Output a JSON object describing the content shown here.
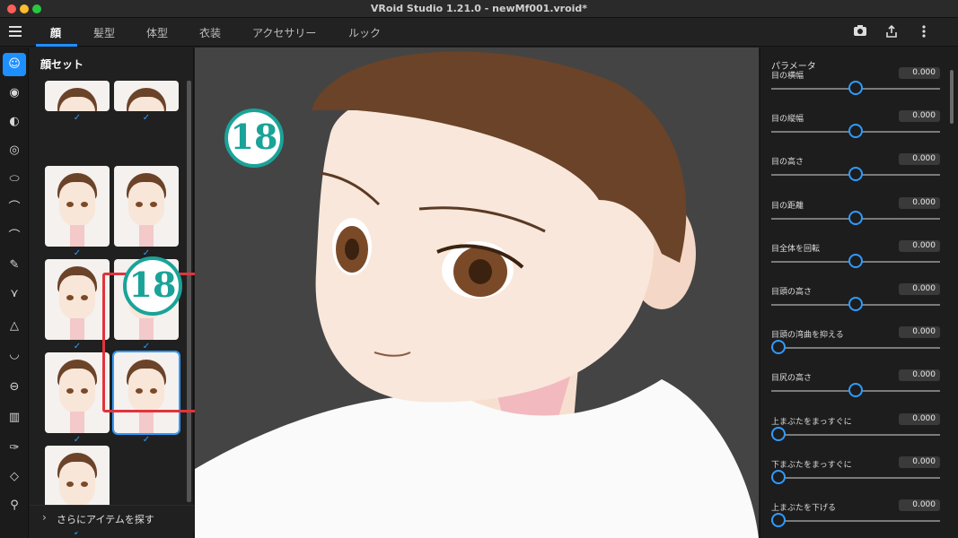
{
  "window": {
    "title": "VRoid Studio 1.21.0 - newMf001.vroid*"
  },
  "nav": {
    "tabs": [
      {
        "label": "顔"
      },
      {
        "label": "髪型"
      },
      {
        "label": "体型"
      },
      {
        "label": "衣装"
      },
      {
        "label": "アクセサリー"
      },
      {
        "label": "ルック"
      }
    ],
    "active_tab": "顔",
    "actions": [
      "camera-icon",
      "share-icon",
      "more-icon"
    ]
  },
  "rail": {
    "icons": [
      "face-preset-icon",
      "eye-icon",
      "iris-icon",
      "eye-highlight-icon",
      "eye-white-icon",
      "eyebrow-icon",
      "eyelash-icon",
      "eyeline-icon",
      "eyelid-icon",
      "nose-icon",
      "mouth-icon",
      "teeth-icon",
      "ear-icon",
      "face-shape-icon",
      "jaw-icon",
      "face-paint-icon"
    ]
  },
  "preset_panel": {
    "title": "顔セット",
    "check": "✓",
    "more_items": "さらにアイテムを探す"
  },
  "badge": {
    "text": "18"
  },
  "params": {
    "title": "パラメータ",
    "items": [
      {
        "name": "目の横幅",
        "value": "0.000",
        "level": 0.5
      },
      {
        "name": "目の縦幅",
        "value": "0.000",
        "level": 0.5
      },
      {
        "name": "目の高さ",
        "value": "0.000",
        "level": 0.5
      },
      {
        "name": "目の距離",
        "value": "0.000",
        "level": 0.5
      },
      {
        "name": "目全体を回転",
        "value": "0.000",
        "level": 0.5
      },
      {
        "name": "目頭の高さ",
        "value": "0.000",
        "level": 0.5
      },
      {
        "name": "目頭の湾曲を抑える",
        "value": "0.000",
        "level": 0.0
      },
      {
        "name": "目尻の高さ",
        "value": "0.000",
        "level": 0.5
      },
      {
        "name": "上まぶたをまっすぐに",
        "value": "0.000",
        "level": 0.0
      },
      {
        "name": "下まぶたをまっすぐに",
        "value": "0.000",
        "level": 0.0
      },
      {
        "name": "上まぶたを下げる",
        "value": "0.000",
        "level": 0.0
      }
    ]
  },
  "colors": {
    "accent": "#1e8fff",
    "badge_teal": "#1aa398",
    "selection_red": "#e0343c",
    "hair": "#6b4328",
    "skin": "#f8e6d9"
  }
}
